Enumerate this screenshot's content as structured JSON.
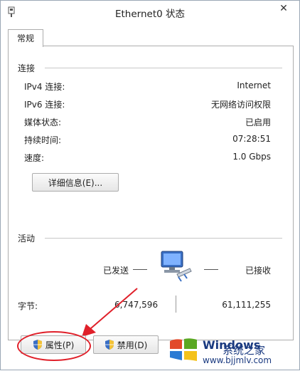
{
  "window": {
    "title": "Ethernet0 状态"
  },
  "tabs": [
    {
      "label": "常规"
    }
  ],
  "connection": {
    "section_label": "连接",
    "rows": [
      {
        "label": "IPv4 连接:",
        "value": "Internet"
      },
      {
        "label": "IPv6 连接:",
        "value": "无网络访问权限"
      },
      {
        "label": "媒体状态:",
        "value": "已启用"
      },
      {
        "label": "持续时间:",
        "value": "07:28:51"
      },
      {
        "label": "速度:",
        "value": "1.0 Gbps"
      }
    ],
    "details_button": "详细信息(E)..."
  },
  "activity": {
    "section_label": "活动",
    "sent_label": "已发送",
    "received_label": "已接收",
    "bytes_label": "字节:",
    "bytes_sent": "6,747,596",
    "bytes_received": "61,111,255"
  },
  "buttons": {
    "properties": "属性(P)",
    "disable": "禁用(D)"
  },
  "watermark": {
    "title": "Windows",
    "subtitle": "系统之家",
    "url": "www.bjjmlv.com"
  },
  "colors": {
    "annotation_red": "#e0202a",
    "window_border": "#9aa7b5",
    "watermark_blue": "#1a3a80"
  },
  "icons": {
    "app": "network-adapter-icon",
    "close": "close-icon",
    "activity": "network-computer-icon",
    "uac": "uac-shield-icon"
  }
}
